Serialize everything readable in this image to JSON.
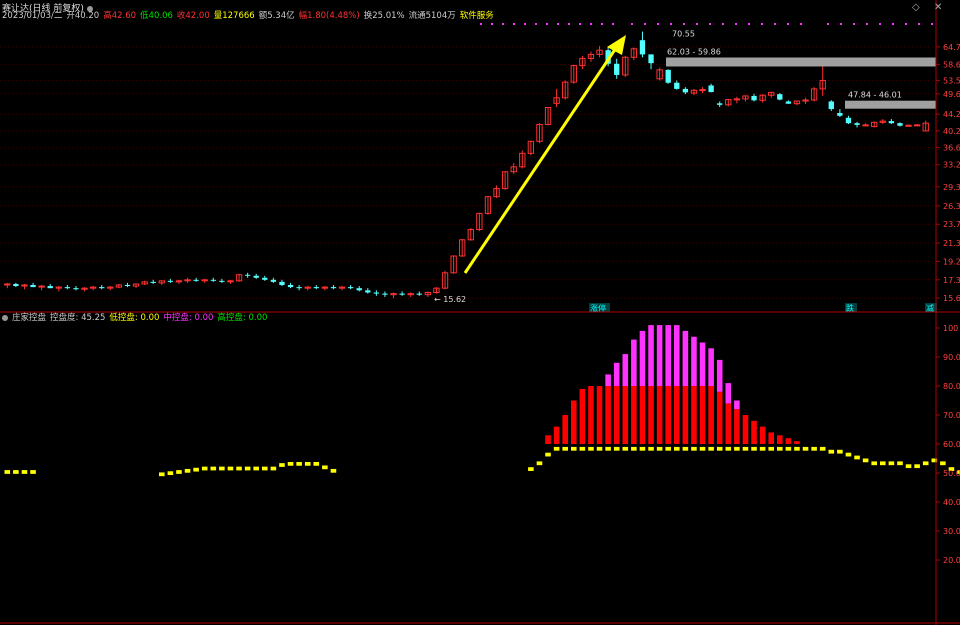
{
  "header": {
    "title": "赛让达(日线 前复权)",
    "date": "2023/01/03/二",
    "open_label": "开40.20",
    "high_label": "高42.60",
    "low_label": "低40.06",
    "close_label": "收42.00",
    "volume_label": "量127666",
    "amount_label": "额5.34亿",
    "change_label": "幅1.80(4.48%)",
    "turnover_label": "换25.01%",
    "float_label": "流通5104万",
    "service_label": "软件服务"
  },
  "indicator": {
    "name": "庄家控盘",
    "control_label": "控盘度: 45.25",
    "low_label": "低控盘: 0.00",
    "mid_label": "中控盘: 0.00",
    "high_label": "高控盘: 0.00"
  },
  "colors": {
    "up": "#ff3232",
    "down": "#54ffff",
    "axis": "#b00000",
    "yellow": "#ffff00",
    "red": "#ff0000",
    "magenta": "#ff33ff",
    "gray_bar": "#a0a0a0"
  },
  "icons": {
    "settings": "diamond-icon",
    "close": "close-icon"
  },
  "chart_data": [
    {
      "type": "candlestick",
      "y_ticks": [
        "64.7",
        "58.6",
        "53.5",
        "49.6",
        "44.2",
        "40.2",
        "36.6",
        "33.2",
        "29.3",
        "26.3",
        "23.7",
        "21.3",
        "19.2",
        "17.3",
        "15.6"
      ],
      "ylim": [
        15.0,
        70.55
      ],
      "annotations": [
        "70.55",
        "62.03 - 59.86",
        "47.84 - 46.01",
        "15.62"
      ],
      "markers": [
        "涨停",
        "跌",
        "减"
      ],
      "candles": [
        [
          16.8,
          17.0,
          16.5,
          16.9
        ],
        [
          16.9,
          17.0,
          16.6,
          16.7
        ],
        [
          16.7,
          16.9,
          16.4,
          16.8
        ],
        [
          16.8,
          17.0,
          16.6,
          16.6
        ],
        [
          16.6,
          16.8,
          16.3,
          16.7
        ],
        [
          16.7,
          16.9,
          16.5,
          16.5
        ],
        [
          16.5,
          16.7,
          16.2,
          16.6
        ],
        [
          16.6,
          16.8,
          16.4,
          16.5
        ],
        [
          16.5,
          16.7,
          16.3,
          16.4
        ],
        [
          16.4,
          16.6,
          16.2,
          16.5
        ],
        [
          16.5,
          16.7,
          16.3,
          16.6
        ],
        [
          16.6,
          16.8,
          16.4,
          16.5
        ],
        [
          16.5,
          16.7,
          16.3,
          16.6
        ],
        [
          16.6,
          16.9,
          16.5,
          16.8
        ],
        [
          16.8,
          17.0,
          16.6,
          16.7
        ],
        [
          16.7,
          16.9,
          16.5,
          16.9
        ],
        [
          16.9,
          17.2,
          16.8,
          17.1
        ],
        [
          17.1,
          17.3,
          16.9,
          17.0
        ],
        [
          17.0,
          17.2,
          16.8,
          17.2
        ],
        [
          17.2,
          17.4,
          17.0,
          17.1
        ],
        [
          17.1,
          17.3,
          16.9,
          17.2
        ],
        [
          17.2,
          17.5,
          17.0,
          17.3
        ],
        [
          17.3,
          17.5,
          17.1,
          17.2
        ],
        [
          17.2,
          17.4,
          17.0,
          17.3
        ],
        [
          17.3,
          17.5,
          17.1,
          17.2
        ],
        [
          17.2,
          17.4,
          17.0,
          17.1
        ],
        [
          17.1,
          17.3,
          16.9,
          17.2
        ],
        [
          17.2,
          17.9,
          17.1,
          17.8
        ],
        [
          17.8,
          18.0,
          17.5,
          17.7
        ],
        [
          17.7,
          17.9,
          17.4,
          17.5
        ],
        [
          17.5,
          17.7,
          17.2,
          17.3
        ],
        [
          17.3,
          17.5,
          17.0,
          17.1
        ],
        [
          17.1,
          17.3,
          16.7,
          16.8
        ],
        [
          16.8,
          17.0,
          16.5,
          16.6
        ],
        [
          16.6,
          16.8,
          16.3,
          16.5
        ],
        [
          16.5,
          16.7,
          16.3,
          16.6
        ],
        [
          16.6,
          16.8,
          16.4,
          16.5
        ],
        [
          16.5,
          16.7,
          16.3,
          16.6
        ],
        [
          16.6,
          16.8,
          16.4,
          16.5
        ],
        [
          16.5,
          16.7,
          16.3,
          16.6
        ],
        [
          16.6,
          16.8,
          16.4,
          16.5
        ],
        [
          16.5,
          16.7,
          16.2,
          16.3
        ],
        [
          16.3,
          16.5,
          16.0,
          16.1
        ],
        [
          16.1,
          16.3,
          15.8,
          16.0
        ],
        [
          16.0,
          16.2,
          15.7,
          15.9
        ],
        [
          15.9,
          16.1,
          15.6,
          16.0
        ],
        [
          16.0,
          16.2,
          15.8,
          15.9
        ],
        [
          15.9,
          16.1,
          15.7,
          16.0
        ],
        [
          16.0,
          16.2,
          15.8,
          15.9
        ],
        [
          15.9,
          16.2,
          15.7,
          16.1
        ],
        [
          16.1,
          16.6,
          16.0,
          16.5
        ],
        [
          16.5,
          18.2,
          16.4,
          18.0
        ],
        [
          18.0,
          19.8,
          17.9,
          19.8
        ],
        [
          19.8,
          21.8,
          19.7,
          21.7
        ],
        [
          21.7,
          23.2,
          21.6,
          23.0
        ],
        [
          23.0,
          25.3,
          22.8,
          25.2
        ],
        [
          25.2,
          27.8,
          25.0,
          27.7
        ],
        [
          27.7,
          29.5,
          27.5,
          29.0
        ],
        [
          29.0,
          32.0,
          28.8,
          31.9
        ],
        [
          31.9,
          33.5,
          31.5,
          32.8
        ],
        [
          32.8,
          36.0,
          32.5,
          35.4
        ],
        [
          35.4,
          38.0,
          35.0,
          37.9
        ],
        [
          37.9,
          42.0,
          37.5,
          41.7
        ],
        [
          41.7,
          46.0,
          41.5,
          45.9
        ],
        [
          47.0,
          51.0,
          46.0,
          48.5
        ],
        [
          48.5,
          53.5,
          48.0,
          53.0
        ],
        [
          53.0,
          58.5,
          52.5,
          58.2
        ],
        [
          58.2,
          61.5,
          57.0,
          60.6
        ],
        [
          60.6,
          63.0,
          59.5,
          62.0
        ],
        [
          62.0,
          65.0,
          61.0,
          63.5
        ],
        [
          63.5,
          64.5,
          58.0,
          58.8
        ],
        [
          58.8,
          60.5,
          54.0,
          55.2
        ],
        [
          55.2,
          61.5,
          54.5,
          61.0
        ],
        [
          61.0,
          64.5,
          60.0,
          64.0
        ],
        [
          67.2,
          70.55,
          61.0,
          62.0
        ],
        [
          62.0,
          62.03,
          57.0,
          59.0
        ],
        [
          54.0,
          57.5,
          53.5,
          56.8
        ],
        [
          56.8,
          57.0,
          52.5,
          52.8
        ],
        [
          52.8,
          53.5,
          50.8,
          51.0
        ],
        [
          51.0,
          51.5,
          49.5,
          50.0
        ],
        [
          49.8,
          51.0,
          49.2,
          50.6
        ],
        [
          50.6,
          51.5,
          49.8,
          50.8
        ],
        [
          52.0,
          52.5,
          50.0,
          50.1
        ],
        [
          47.0,
          47.5,
          46.0,
          46.6
        ],
        [
          46.6,
          48.2,
          46.2,
          48.0
        ],
        [
          48.0,
          48.8,
          47.0,
          48.2
        ],
        [
          48.2,
          49.2,
          47.5,
          49.0
        ],
        [
          49.0,
          49.6,
          47.5,
          47.8
        ],
        [
          47.8,
          49.5,
          47.2,
          49.2
        ],
        [
          49.2,
          50.2,
          48.5,
          50.0
        ],
        [
          49.5,
          49.8,
          47.8,
          48.0
        ],
        [
          47.5,
          47.8,
          46.8,
          46.9
        ],
        [
          46.9,
          47.8,
          46.5,
          47.6
        ],
        [
          47.6,
          48.5,
          46.8,
          47.9
        ],
        [
          47.9,
          51.5,
          47.5,
          51.0
        ],
        [
          51.0,
          59.0,
          49.0,
          53.5
        ],
        [
          47.5,
          47.84,
          45.0,
          45.5
        ],
        [
          44.5,
          45.5,
          43.5,
          43.8
        ],
        [
          43.3,
          43.8,
          41.8,
          42.0
        ],
        [
          42.0,
          42.3,
          41.0,
          41.6
        ],
        [
          41.6,
          42.0,
          41.3,
          41.6
        ],
        [
          41.2,
          42.4,
          41.0,
          42.2
        ],
        [
          42.2,
          43.0,
          41.8,
          42.5
        ],
        [
          42.5,
          43.0,
          41.8,
          42.0
        ],
        [
          42.0,
          42.2,
          41.2,
          41.4
        ],
        [
          41.4,
          41.7,
          41.2,
          41.5
        ],
        [
          41.5,
          41.8,
          41.3,
          41.6
        ],
        [
          40.2,
          42.6,
          40.06,
          42.0
        ]
      ]
    },
    {
      "type": "bar",
      "stacked": true,
      "y_ticks": [
        "100",
        "90.0",
        "80.0",
        "70.0",
        "60.0",
        "50.0",
        "40.0",
        "30.0",
        "20.0"
      ],
      "ylim": [
        0,
        100
      ],
      "series": [
        {
          "name": "控盘度",
          "values": [
            51,
            51,
            51,
            51,
            null,
            null,
            null,
            null,
            null,
            null,
            null,
            null,
            null,
            null,
            null,
            null,
            null,
            null,
            50.2,
            50.6,
            51,
            51.4,
            51.8,
            52.2,
            52.2,
            52.2,
            52.2,
            52.2,
            52.2,
            52.2,
            52.2,
            52.2,
            53.4,
            53.8,
            53.8,
            53.8,
            53.8,
            52.6,
            51.4,
            null,
            null,
            null,
            null,
            null,
            null,
            null,
            null,
            null,
            null,
            null,
            null,
            null,
            null,
            null,
            null,
            null,
            null,
            null,
            null,
            null,
            null,
            52,
            54,
            57,
            59,
            59,
            59,
            59,
            59,
            59,
            59,
            59,
            59,
            59,
            59,
            59,
            59,
            59,
            59,
            59,
            59,
            59,
            59,
            59,
            59,
            59,
            59,
            59,
            59,
            59,
            59,
            59,
            59,
            59,
            59,
            59,
            58,
            58,
            57,
            56,
            55,
            54,
            54,
            54,
            54,
            53,
            53,
            54,
            55,
            54,
            52,
            51
          ]
        },
        {
          "name": "低控盘",
          "values": [
            0,
            0,
            0,
            0,
            null,
            null,
            null,
            null,
            null,
            null,
            null,
            null,
            null,
            null,
            null,
            null,
            null,
            null,
            0,
            0,
            0,
            0,
            0,
            0,
            0,
            0,
            0,
            0,
            0,
            0,
            0,
            0,
            0,
            0,
            0,
            0,
            0,
            0,
            0,
            null,
            null,
            null,
            null,
            null,
            null,
            null,
            null,
            null,
            null,
            null,
            null,
            null,
            null,
            null,
            null,
            null,
            null,
            null,
            null,
            null,
            null,
            0,
            0,
            3,
            6,
            10,
            15,
            19,
            20,
            20,
            20,
            20,
            20,
            20,
            20,
            20,
            20,
            20,
            20,
            20,
            20,
            20,
            20,
            18,
            14,
            12,
            10,
            8,
            6,
            4,
            3,
            2,
            1,
            0,
            0,
            0,
            0,
            0,
            0,
            0,
            0,
            0,
            0,
            0,
            0,
            0,
            0,
            0,
            0,
            0,
            0,
            0
          ]
        },
        {
          "name": "中控盘",
          "values": [
            0,
            0,
            0,
            0,
            null,
            null,
            null,
            null,
            null,
            null,
            null,
            null,
            null,
            null,
            null,
            null,
            null,
            null,
            0,
            0,
            0,
            0,
            0,
            0,
            0,
            0,
            0,
            0,
            0,
            0,
            0,
            0,
            0,
            0,
            0,
            0,
            0,
            0,
            0,
            null,
            null,
            null,
            null,
            null,
            null,
            null,
            null,
            null,
            null,
            null,
            null,
            null,
            null,
            null,
            null,
            null,
            null,
            null,
            null,
            null,
            null,
            0,
            0,
            0,
            0,
            0,
            0,
            0,
            0,
            0,
            4,
            8,
            11,
            16,
            19,
            21,
            21,
            21,
            21,
            19,
            17,
            15,
            13,
            11,
            7,
            3,
            0,
            0,
            0,
            0,
            0,
            0,
            0,
            0,
            0,
            0,
            0,
            0,
            0,
            0,
            0,
            0,
            0,
            0,
            0,
            0,
            0,
            0,
            0,
            0,
            0,
            0
          ]
        }
      ]
    }
  ]
}
